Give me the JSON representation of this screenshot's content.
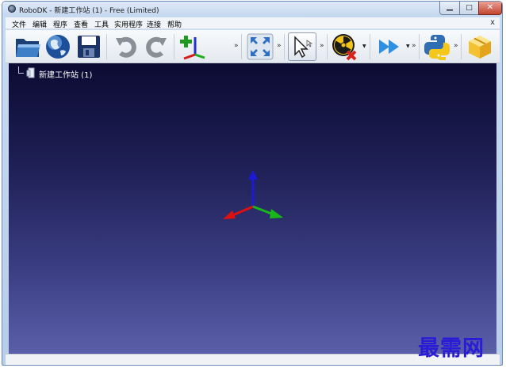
{
  "window": {
    "title": "RoboDK - 新建工作站 (1) - Free (Limited)",
    "controls": {
      "minimize": "▁",
      "maximize": "□",
      "close": "✕"
    }
  },
  "menu": {
    "items": [
      "文件",
      "编辑",
      "程序",
      "查看",
      "工具",
      "实用程序",
      "连接",
      "帮助"
    ],
    "close": "x"
  },
  "toolbar": {
    "overflow": "»",
    "dropdown": "▼",
    "buttons": [
      "open-folder-icon",
      "open-online-library-icon",
      "save-icon",
      "undo-icon",
      "redo-icon",
      "add-reference-frame-icon",
      "fit-all-icon",
      "select-pointer-icon",
      "collision-check-icon",
      "simulation-speed-icon",
      "python-icon",
      "package-icon"
    ]
  },
  "tree": {
    "station_name": "新建工作站 (1)"
  },
  "watermark": "最需网",
  "colors": {
    "viewport_top": "#0c0b33",
    "viewport_bottom": "#5a5fa8",
    "axis_x": "#e01010",
    "axis_y": "#18b818",
    "axis_z": "#1a1ad8"
  }
}
